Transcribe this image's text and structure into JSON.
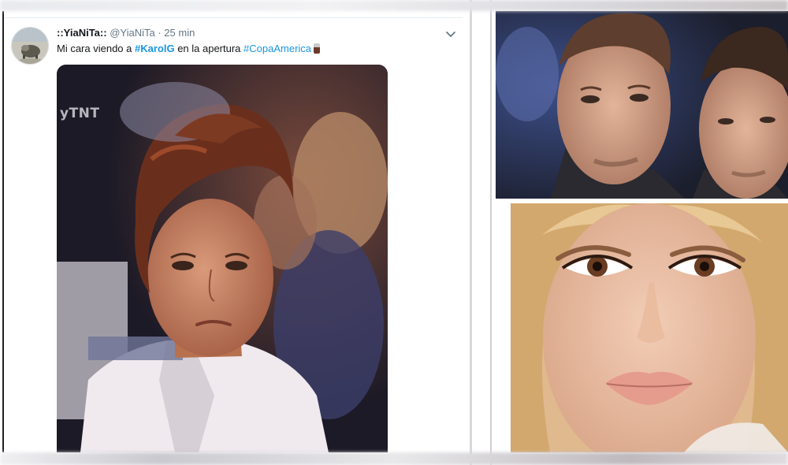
{
  "tweet": {
    "display_name": "::YiaNiTa::",
    "handle": "@YiaNiTa",
    "separator": "·",
    "time": "25 min",
    "text_prefix": "Mi cara viendo a ",
    "hashtag_1": "#KarolG",
    "text_middle": " en la apertura ",
    "hashtag_2": "#CopaAmerica",
    "media_watermark": "yTNT"
  },
  "icons": {
    "caret": "chevron-down-icon",
    "emoji": "drink-emoji"
  },
  "colors": {
    "link": "#1b95e0",
    "text": "#14171a",
    "secondary": "#657786"
  }
}
